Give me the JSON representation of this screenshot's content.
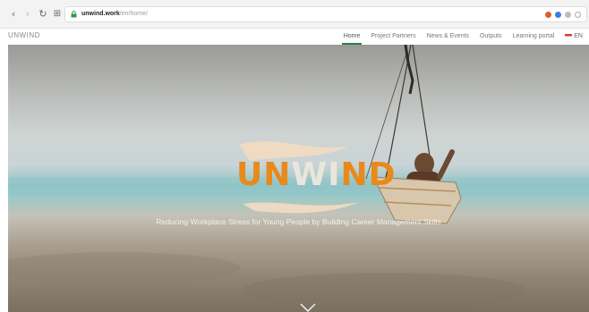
{
  "browser": {
    "url_host": "unwind.work",
    "url_path": "/en/home/",
    "nav_icons": {
      "back": "‹",
      "forward": "›",
      "reload": "↻",
      "apps": "⊞"
    }
  },
  "site": {
    "logo": "UNWIND",
    "nav": [
      {
        "label": "Home",
        "active": true
      },
      {
        "label": "Project Partners",
        "active": false
      },
      {
        "label": "News & Events",
        "active": false
      },
      {
        "label": "Outputs",
        "active": false
      },
      {
        "label": "Learning portal",
        "active": false
      }
    ],
    "language": "EN"
  },
  "hero": {
    "logo_parts": [
      "UN",
      "WI",
      "ND"
    ],
    "tagline": "Reducing Workplace Stress for Young People by Building Career Management Skills"
  },
  "colors": {
    "accent_green": "#2e7d53",
    "logo_orange": "#e8891c"
  }
}
